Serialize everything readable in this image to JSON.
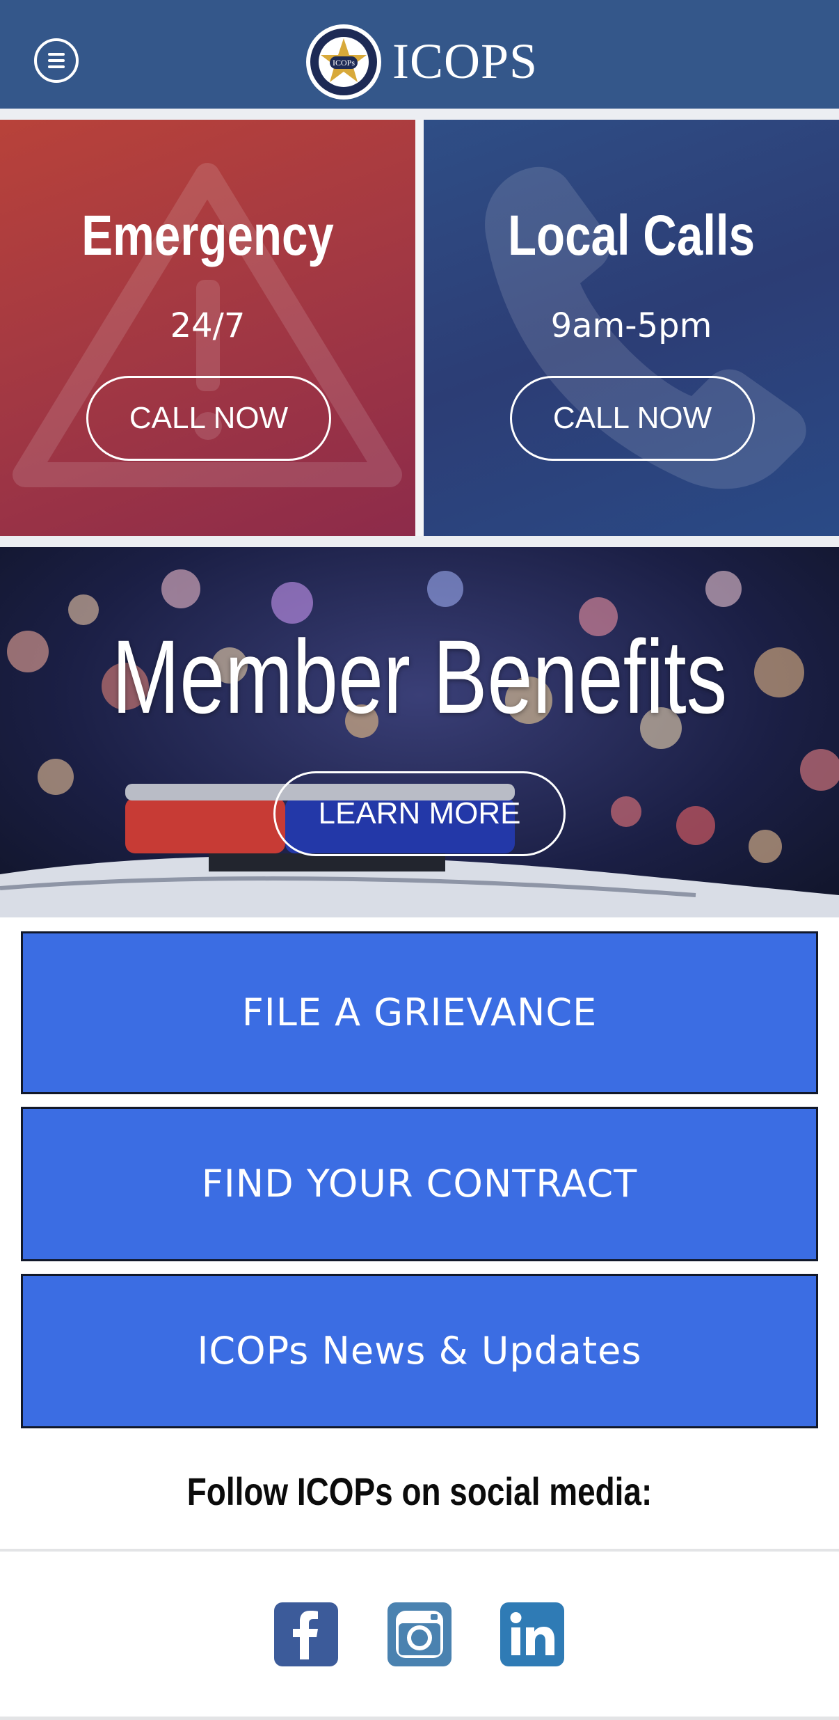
{
  "header": {
    "brand": "ICOPS",
    "logo": {
      "ring_text": "Illinois Council Of Police",
      "center_text": "ICOPs",
      "motto": "A Union with One Voice"
    },
    "menu_icon": "hamburger-menu-icon"
  },
  "call_panels": [
    {
      "title": "Emergency",
      "hours": "24/7",
      "button": "CALL NOW",
      "icon": "warning-triangle-icon"
    },
    {
      "title": "Local Calls",
      "hours": "9am-5pm",
      "button": "CALL NOW",
      "icon": "phone-icon"
    }
  ],
  "benefits": {
    "title": "Member Benefits",
    "button": "LEARN MORE"
  },
  "actions": [
    {
      "label": "FILE A GRIEVANCE"
    },
    {
      "label": "FIND YOUR CONTRACT"
    },
    {
      "label": "ICOPs News & Updates"
    }
  ],
  "social": {
    "heading": "Follow ICOPs on social media:",
    "icons": [
      "facebook-icon",
      "instagram-icon",
      "linkedin-icon"
    ]
  },
  "colors": {
    "header": "#34578a",
    "emergency": "#a23843",
    "local": "#2c3d75",
    "action_button": "#3b6de3"
  }
}
